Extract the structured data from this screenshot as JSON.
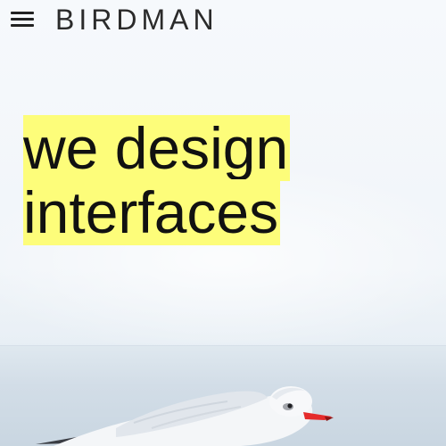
{
  "header": {
    "brand": "BIRDMAN",
    "menu_icon": "hamburger-menu-icon"
  },
  "hero": {
    "headline_line1": "we design",
    "headline_line2": "interfaces",
    "highlight_color": "#fdfd7a",
    "image": "seagull-over-sea"
  }
}
